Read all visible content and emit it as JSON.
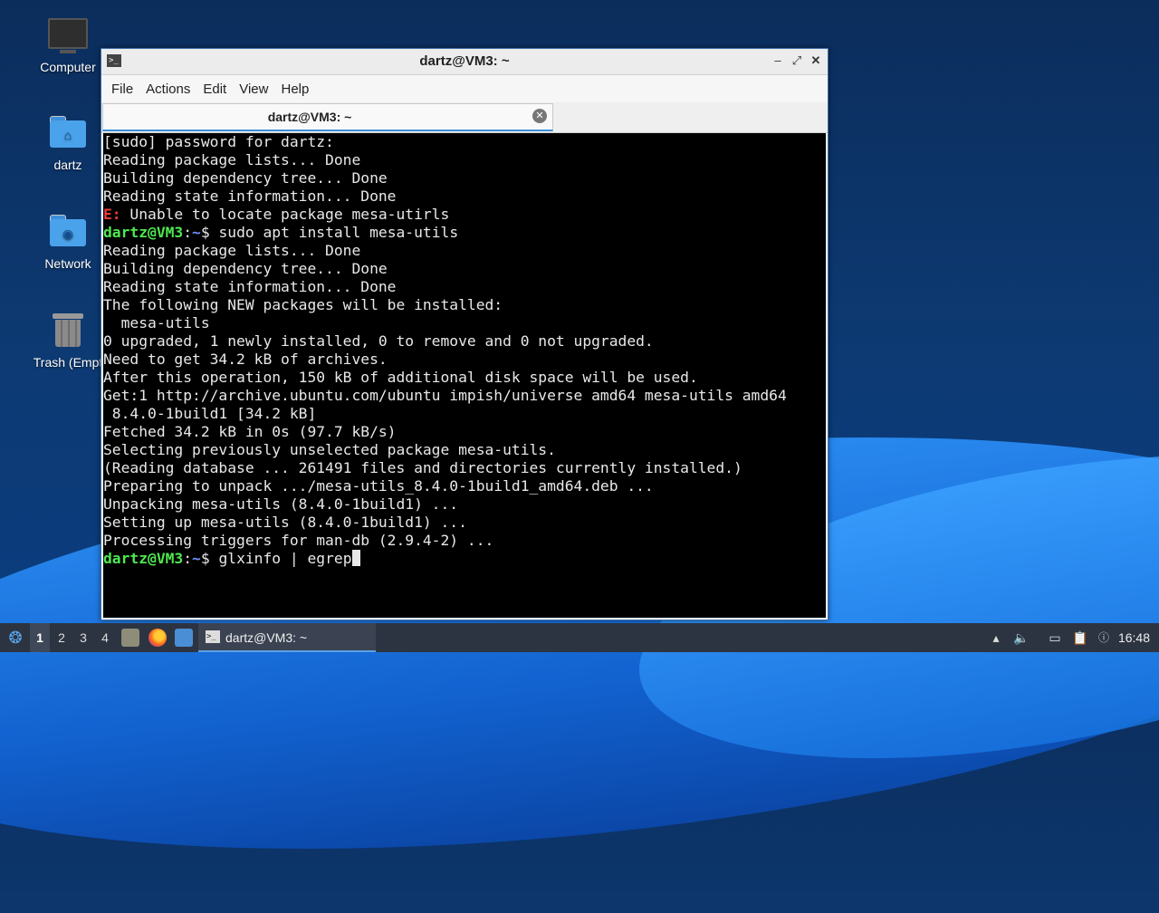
{
  "desktop": {
    "icons": [
      {
        "label": "Computer",
        "icon": "computer-icon"
      },
      {
        "label": "dartz",
        "icon": "home-folder-icon"
      },
      {
        "label": "Network",
        "icon": "network-folder-icon"
      },
      {
        "label": "Trash (Empt",
        "icon": "trash-icon"
      }
    ]
  },
  "window": {
    "title": "dartz@VM3: ~",
    "menu": [
      "File",
      "Actions",
      "Edit",
      "View",
      "Help"
    ],
    "tab_label": "dartz@VM3: ~"
  },
  "terminal": {
    "prompt_user": "dartz@VM3",
    "prompt_path": "~",
    "lines": [
      "[sudo] password for dartz:",
      "Reading package lists... Done",
      "Building dependency tree... Done",
      "Reading state information... Done",
      " Unable to locate package mesa-utirls",
      "$ sudo apt install mesa-utils",
      "Reading package lists... Done",
      "Building dependency tree... Done",
      "Reading state information... Done",
      "The following NEW packages will be installed:",
      "  mesa-utils",
      "0 upgraded, 1 newly installed, 0 to remove and 0 not upgraded.",
      "Need to get 34.2 kB of archives.",
      "After this operation, 150 kB of additional disk space will be used.",
      "Get:1 http://archive.ubuntu.com/ubuntu impish/universe amd64 mesa-utils amd64",
      " 8.4.0-1build1 [34.2 kB]",
      "Fetched 34.2 kB in 0s (97.7 kB/s)",
      "Selecting previously unselected package mesa-utils.",
      "(Reading database ... 261491 files and directories currently installed.)",
      "Preparing to unpack .../mesa-utils_8.4.0-1build1_amd64.deb ...",
      "Unpacking mesa-utils (8.4.0-1build1) ...",
      "Setting up mesa-utils (8.4.0-1build1) ...",
      "Processing triggers for man-db (2.9.4-2) ...",
      "$ glxinfo | egrep"
    ],
    "error_prefix": "E:",
    "prompt_separator": ":"
  },
  "taskbar": {
    "workspaces": [
      "1",
      "2",
      "3",
      "4"
    ],
    "active_workspace": "1",
    "task_label": "dartz@VM3: ~",
    "clock": "16:48"
  }
}
